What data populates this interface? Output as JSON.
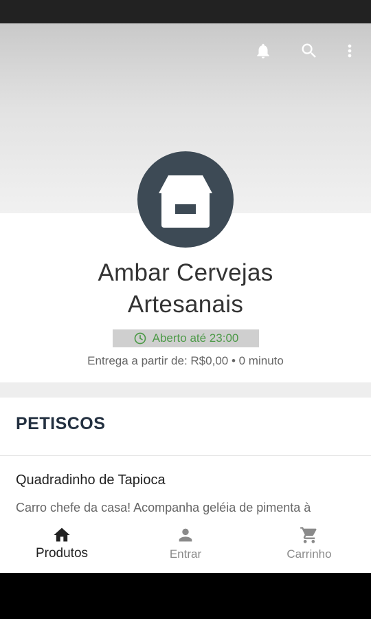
{
  "store": {
    "name_line1": "Ambar Cervejas",
    "name_line2": "Artesanais",
    "open_status": "Aberto até 23:00",
    "delivery_info": "Entrega a partir de: R$0,00 • 0 minuto"
  },
  "topbar": {
    "icons": [
      "bell-icon",
      "search-icon",
      "more-vert-icon"
    ]
  },
  "section": {
    "title": "PETISCOS"
  },
  "product": {
    "name": "Quadradinho de Tapioca",
    "description": "Carro chefe da casa! Acompanha geléia de pimenta à"
  },
  "nav": {
    "items": [
      {
        "label": "Produtos",
        "icon": "home-icon",
        "active": true
      },
      {
        "label": "Entrar",
        "icon": "person-icon",
        "active": false
      },
      {
        "label": "Carrinho",
        "icon": "cart-icon",
        "active": false
      }
    ]
  },
  "colors": {
    "avatar_bg": "#3d4a55",
    "open_green": "#4d9a48",
    "title_dark": "#233040"
  }
}
